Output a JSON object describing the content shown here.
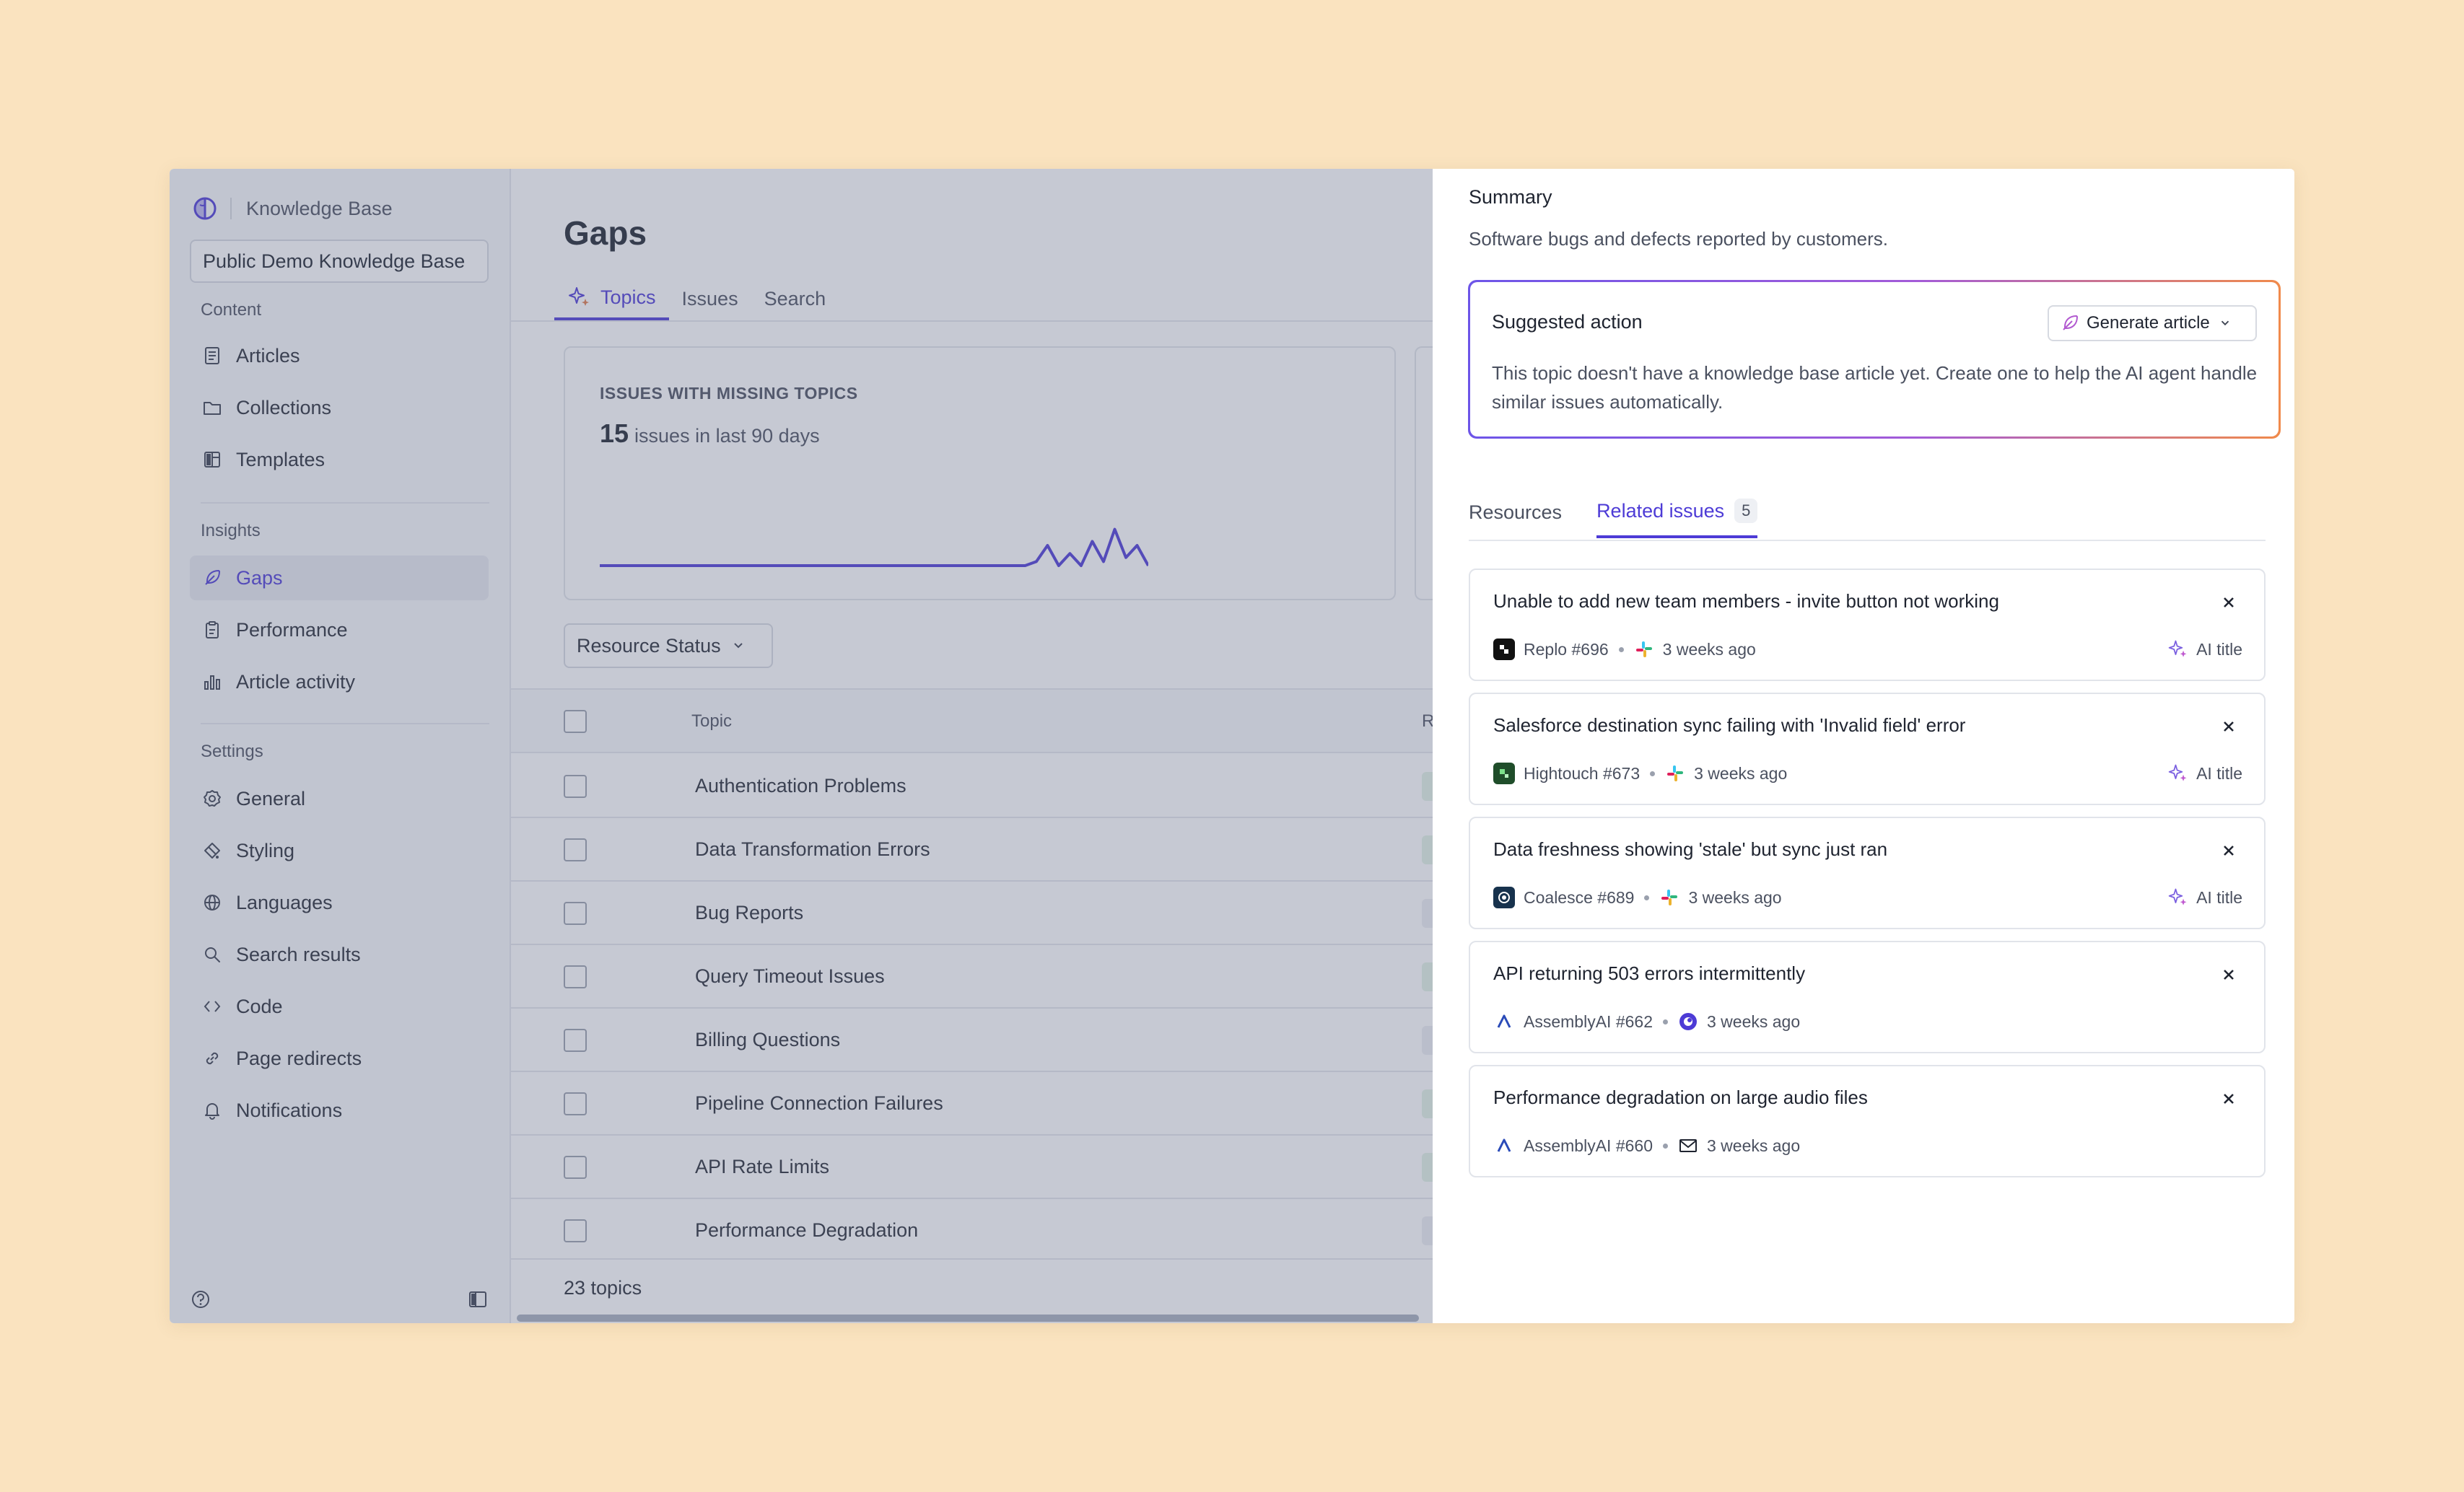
{
  "brand": {
    "name": "Knowledge Base"
  },
  "kb_selector": {
    "value": "Public Demo Knowledge Base"
  },
  "sidebar": {
    "content_label": "Content",
    "content_items": [
      {
        "label": "Articles",
        "icon": "document-icon"
      },
      {
        "label": "Collections",
        "icon": "folder-icon"
      },
      {
        "label": "Templates",
        "icon": "layout-icon"
      }
    ],
    "insights_label": "Insights",
    "insights_items": [
      {
        "label": "Gaps",
        "icon": "feather-icon",
        "active": true
      },
      {
        "label": "Performance",
        "icon": "clipboard-icon"
      },
      {
        "label": "Article activity",
        "icon": "bar-chart-icon"
      }
    ],
    "settings_label": "Settings",
    "settings_items": [
      {
        "label": "General",
        "icon": "gear-icon"
      },
      {
        "label": "Styling",
        "icon": "paint-icon"
      },
      {
        "label": "Languages",
        "icon": "globe-icon"
      },
      {
        "label": "Search results",
        "icon": "search-icon"
      },
      {
        "label": "Code",
        "icon": "code-icon"
      },
      {
        "label": "Page redirects",
        "icon": "link-icon"
      },
      {
        "label": "Notifications",
        "icon": "bell-icon"
      }
    ]
  },
  "main": {
    "title": "Gaps",
    "tabs": [
      {
        "label": "Topics",
        "active": true
      },
      {
        "label": "Issues"
      },
      {
        "label": "Search"
      }
    ],
    "card": {
      "label": "ISSUES WITH MISSING TOPICS",
      "count": "15",
      "count_suffix": "issues in last 90 days"
    },
    "sparkline": [
      0,
      0,
      0,
      0,
      0,
      0,
      0,
      0,
      0,
      0,
      0,
      0,
      0,
      0,
      0,
      0,
      0,
      0,
      0,
      0,
      0,
      0,
      0,
      0,
      0,
      0,
      0,
      0,
      0,
      0,
      0,
      0,
      0,
      0,
      0,
      0,
      0,
      0,
      0,
      0.1,
      0.5,
      0,
      0.3,
      0,
      0.6,
      0.1,
      0.9,
      0.2,
      0.5,
      0
    ],
    "filter": {
      "label": "Resource Status"
    },
    "table": {
      "header_topic": "Topic",
      "header_col2": "R",
      "rows": [
        "Authentication Problems",
        "Data Transformation Errors",
        "Bug Reports",
        "Query Timeout Issues",
        "Billing Questions",
        "Pipeline Connection Failures",
        "API Rate Limits",
        "Performance Degradation"
      ],
      "footer": "23 topics"
    }
  },
  "panel": {
    "summary_title": "Summary",
    "summary_text": "Software bugs and defects reported by customers.",
    "suggested": {
      "title": "Suggested action",
      "button_label": "Generate article",
      "text": "This topic doesn't have a knowledge base article yet. Create one to help the AI agent handle similar issues automatically."
    },
    "tabs": [
      {
        "label": "Resources"
      },
      {
        "label": "Related issues",
        "badge": "5",
        "active": true
      }
    ],
    "issues": [
      {
        "title": "Unable to add new team members - invite button not working",
        "source": "Replo #696",
        "source_icon": "replo-logo-icon",
        "channel_icon": "slack-icon",
        "time": "3 weeks ago",
        "ai_label": "AI title"
      },
      {
        "title": "Salesforce destination sync failing with 'Invalid field' error",
        "source": "Hightouch #673",
        "source_icon": "hightouch-logo-icon",
        "channel_icon": "slack-icon",
        "time": "3 weeks ago",
        "ai_label": "AI title"
      },
      {
        "title": "Data freshness showing 'stale' but sync just ran",
        "source": "Coalesce #689",
        "source_icon": "coalesce-logo-icon",
        "channel_icon": "slack-icon",
        "time": "3 weeks ago",
        "ai_label": "AI title"
      },
      {
        "title": "API returning 503 errors intermittently",
        "source": "AssemblyAI #662",
        "source_icon": "assemblyai-logo-icon",
        "channel_icon": "chat-widget-icon",
        "time": "3 weeks ago",
        "ai_label": ""
      },
      {
        "title": "Performance degradation on large audio files",
        "source": "AssemblyAI #660",
        "source_icon": "assemblyai-logo-icon",
        "channel_icon": "mail-icon",
        "time": "3 weeks ago",
        "ai_label": ""
      }
    ]
  },
  "colors": {
    "accent": "#4d3bd6",
    "background": "#fae3bf",
    "overlay": "#606a84"
  }
}
